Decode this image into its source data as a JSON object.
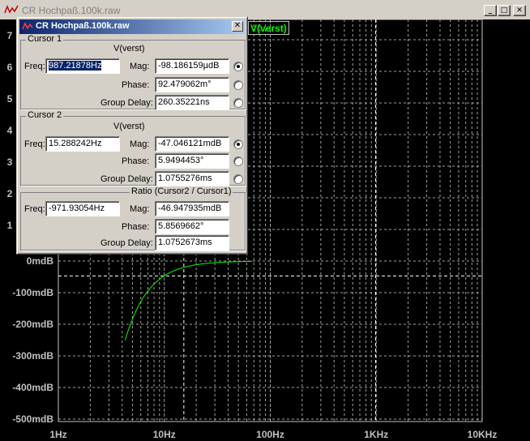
{
  "window": {
    "title": "CR Hochpaß.100k.raw",
    "controls": {
      "minimize": "_",
      "maximize": "□",
      "close": "✕"
    }
  },
  "plot": {
    "trace_label": "V(verst)",
    "trace_color": "#00ff00",
    "grid_color": "#a0a0a0",
    "y_ticks": [
      "0mdB",
      "-100mdB",
      "-200mdB",
      "-300mdB",
      "-400mdB",
      "-500mdB"
    ],
    "x_ticks": [
      "1Hz",
      "10Hz",
      "100Hz",
      "1KHz",
      "10KHz"
    ],
    "partial_left_ticks": [
      "7",
      "6",
      "5",
      "4",
      "3",
      "2",
      "1"
    ]
  },
  "dialog": {
    "title": "CR Hochpaß.100k.raw",
    "close": "✕",
    "cursor1": {
      "label": "Cursor 1",
      "trace": "V(verst)",
      "freq_label": "Freq:",
      "freq": "987.21878Hz",
      "mag_label": "Mag:",
      "mag": "-98.186159µdB",
      "phase_label": "Phase:",
      "phase": "92.479062m°",
      "gd_label": "Group Delay:",
      "gd": "260.35221ns"
    },
    "cursor2": {
      "label": "Cursor 2",
      "trace": "V(verst)",
      "freq_label": "Freq:",
      "freq": "15.288242Hz",
      "mag_label": "Mag:",
      "mag": "-47.046121mdB",
      "phase_label": "Phase:",
      "phase": "5.9494453°",
      "gd_label": "Group Delay:",
      "gd": "1.0755276ms"
    },
    "ratio": {
      "label": "Ratio (Cursor2 / Cursor1)",
      "freq_label": "Freq:",
      "freq": "-971.93054Hz",
      "mag_label": "Mag:",
      "mag": "-46.947935mdB",
      "phase_label": "Phase:",
      "phase": "5.8569662°",
      "gd_label": "Group Delay:",
      "gd": "1.0752673ms"
    }
  }
}
